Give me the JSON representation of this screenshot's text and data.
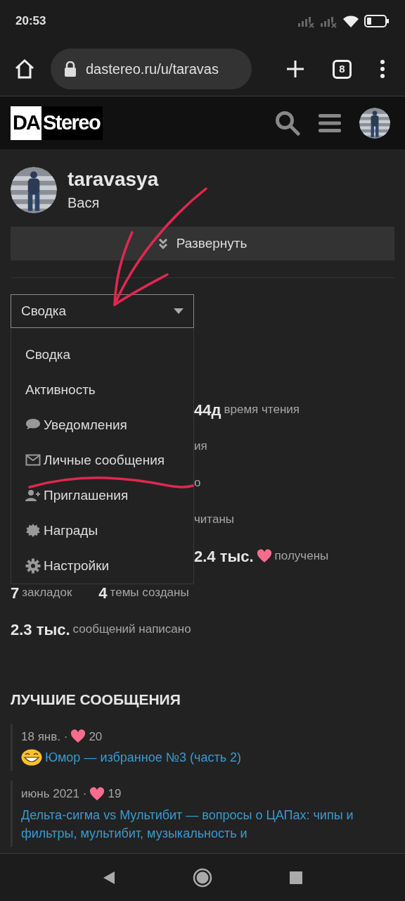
{
  "status_bar": {
    "time": "20:53"
  },
  "browser": {
    "url": "dastereo.ru/u/taravas",
    "tab_count": "8"
  },
  "site_header": {
    "logo": [
      "DA",
      "Stereo"
    ]
  },
  "profile": {
    "username": "taravasya",
    "name": "Вася",
    "expand_button": "Развернуть"
  },
  "view_select": {
    "value": "Сводка",
    "expanded": true,
    "options": [
      {
        "label": "Сводка",
        "kind": "plain"
      },
      {
        "label": "Активность",
        "kind": "plain"
      },
      {
        "label": "Уведомления",
        "kind": "comment"
      },
      {
        "label": "Личные сообщения",
        "kind": "envelope"
      },
      {
        "label": "Приглашения",
        "kind": "invite"
      },
      {
        "label": "Награды",
        "kind": "badge"
      },
      {
        "label": "Настройки",
        "kind": "gear"
      }
    ]
  },
  "stats_rows": [
    {
      "covered": true,
      "items": [
        {
          "value": "44д",
          "label": "время чтения"
        }
      ]
    },
    {
      "covered": true,
      "items": [
        {
          "label": "ия"
        }
      ]
    },
    {
      "covered": true,
      "items": [
        {
          "label": "о"
        }
      ]
    },
    {
      "covered": true,
      "items": [
        {
          "label": "читаны"
        }
      ]
    },
    {
      "covered": true,
      "items": [
        {
          "value": "2.4 тыс.",
          "kind": "likes",
          "label": "получены"
        }
      ]
    },
    {
      "covered": false,
      "items": [
        {
          "value": "7",
          "label": "закладок"
        },
        {
          "value": "4",
          "label": "темы созданы"
        }
      ]
    },
    {
      "covered": false,
      "items": [
        {
          "value": "2.3 тыс.",
          "label": "сообщений написано"
        }
      ]
    }
  ],
  "top_posts": {
    "title": "ЛУЧШИЕ СООБЩЕНИЯ",
    "posts": [
      {
        "date": "18 янв. ·",
        "likes": "20",
        "emoji": true,
        "title": "Юмор — избранное №3 (часть 2)"
      },
      {
        "date": "июнь 2021 ·",
        "likes": "19",
        "emoji": false,
        "title": "Дельта-сигма vs Мультибит — вопросы о ЦАПах: чипы и фильтры, мультибит, музыкальность и"
      }
    ]
  }
}
